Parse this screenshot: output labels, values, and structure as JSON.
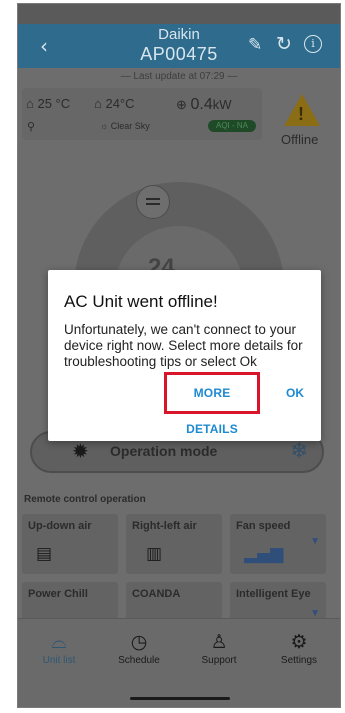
{
  "appbar": {
    "title": "Daikin",
    "subtitle": "AP00475",
    "back_icon": "chevron-left",
    "edit_icon": "pencil",
    "refresh_icon": "refresh",
    "info_icon": "info"
  },
  "last_update": "— Last update at 07:29 —",
  "weather": {
    "indoor_temp": "25 °C",
    "outdoor_temp": "24°C",
    "power": "0.4",
    "power_unit": "kW",
    "condition": "Clear Sky",
    "aqi": "AQI - NA"
  },
  "status": {
    "label": "Offline"
  },
  "dial": {
    "value": "24"
  },
  "operation": {
    "label": "Operation mode"
  },
  "remote": {
    "label": "Remote control operation",
    "tiles": [
      {
        "label": "Up-down air"
      },
      {
        "label": "Right-left air"
      },
      {
        "label": "Fan speed"
      },
      {
        "label": "Power Chill"
      },
      {
        "label": "COANDA"
      },
      {
        "label": "Intelligent Eye"
      }
    ]
  },
  "nav": {
    "items": [
      {
        "label": "Unit list",
        "icon": "router"
      },
      {
        "label": "Schedule",
        "icon": "clock"
      },
      {
        "label": "Support",
        "icon": "person"
      },
      {
        "label": "Settings",
        "icon": "gear"
      }
    ]
  },
  "dialog": {
    "title": "AC Unit went offline!",
    "body": "Unfortunately, we can't connect to your device right now. Select more details for troubleshooting tips or select Ok",
    "more_label": "MORE DETAILS",
    "ok_label": "OK"
  },
  "colors": {
    "accent": "#1e8ad1",
    "highlight": "#d9152c",
    "appbar": "#2f6b8c"
  }
}
